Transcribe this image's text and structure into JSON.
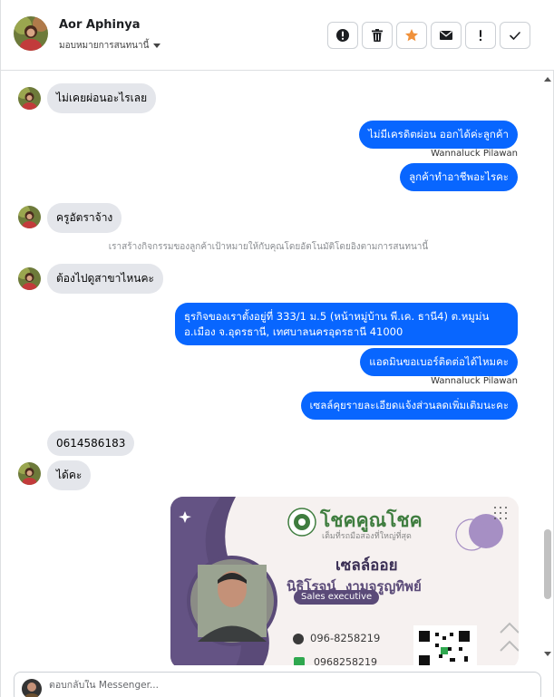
{
  "header": {
    "contact_name": "Aor Aphinya",
    "assign_label": "มอบหมายการสนทนานี้"
  },
  "toolbar": {
    "buttons": [
      {
        "name": "spam-report-button",
        "icon": "exclamation-circle-icon"
      },
      {
        "name": "delete-button",
        "icon": "trash-icon"
      },
      {
        "name": "star-button",
        "icon": "star-icon"
      },
      {
        "name": "mark-unread-button",
        "icon": "envelope-icon"
      },
      {
        "name": "follow-up-button",
        "icon": "exclamation-icon"
      },
      {
        "name": "mark-done-button",
        "icon": "checkmark-icon"
      }
    ]
  },
  "messages": {
    "m1": "ไม่เคยผ่อนอะไรเลย",
    "m2": "ไม่มีเครดิตผ่อน  ออกได้ค่ะลูกค้า",
    "m2_sender": "Wannaluck Pilawan",
    "m3": "ลูกค้าทำอาชีพอะไรคะ",
    "m4": "ครูอัตราจ้าง",
    "system_note": "เราสร้างกิจกรรมของลูกค้าเป้าหมายให้กับคุณโดยอัตโนมัติโดยอิงตามการสนทนานี้",
    "m5": "ต้องไปดูสาขาไหนคะ",
    "m6": "ธุรกิจของเราตั้งอยู่ที่ 333/1 ม.5 (หน้าหมู่บ้าน พี.เค. ธานี4) ต.หมูม่น อ.เมือง จ.อุดรธานี, เทศบาลนครอุดรธานี 41000",
    "m7": "แอดมินขอเบอร์ติดต่อได้ไหมคะ",
    "m7_sender": "Wannaluck Pilawan",
    "m8": "เซลล์คุยรายละเอียดแจ้งส่วนลดเพิ่มเติมนะคะ",
    "m9": "0614586183",
    "m10": "ได้คะ"
  },
  "business_card": {
    "brand": "โชคคูณโชค",
    "tagline": "เต็มที่รถมือสองที่ใหญ่ที่สุด",
    "role_thai": "เซลล์ออย",
    "person_name": "นิธิโรจน์  งามจรูญทิพย์",
    "position": "Sales executive",
    "phone": "096-8258219",
    "phone2": "0968258219"
  },
  "composer": {
    "placeholder": "ตอบกลับใน Messenger..."
  },
  "colors": {
    "outgoing_bubble": "#0866ff",
    "incoming_bubble": "#e4e6eb",
    "card_purple": "#5a4a78",
    "star": "#f0913b"
  }
}
